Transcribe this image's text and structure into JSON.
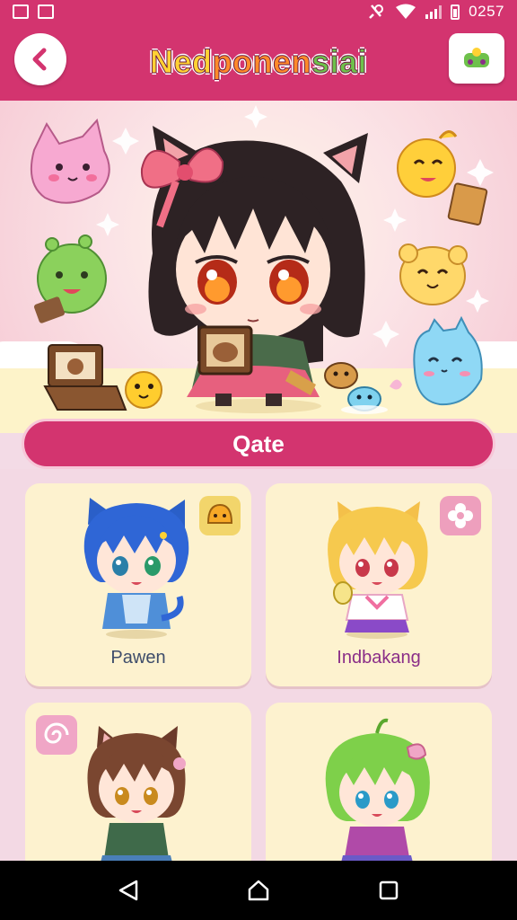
{
  "status_bar": {
    "time": "0257"
  },
  "app_bar": {
    "title_part1": "Ned",
    "title_part2": "ponen",
    "title_part3": "siai",
    "back_icon": "chevron-left-icon",
    "menu_icon": "game-controller-icon"
  },
  "section": {
    "title": "Qate"
  },
  "characters": [
    {
      "name": "Pawen",
      "badge_icon": "sad-face-icon",
      "badge_color": "#f2d56b"
    },
    {
      "name": "Indbakang",
      "badge_icon": "flower-icon",
      "badge_color": "#ee9fbd"
    },
    {
      "name": "",
      "badge_icon": "swirl-icon",
      "badge_color": "#f0a6c6"
    },
    {
      "name": "",
      "badge_icon": "",
      "badge_color": ""
    }
  ],
  "colors": {
    "primary": "#d3346f",
    "card": "#fdf2cf",
    "name_dark": "#3e4d6b",
    "name_purple": "#8a2e88"
  },
  "nav": {
    "back_icon": "nav-back-icon",
    "home_icon": "nav-home-icon",
    "recents_icon": "nav-recents-icon"
  }
}
